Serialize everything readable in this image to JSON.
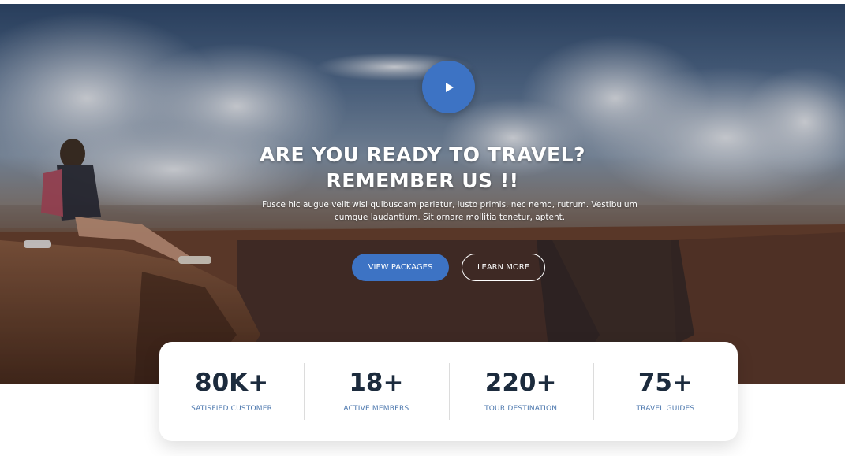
{
  "hero": {
    "headline_line1": "ARE YOU READY TO TRAVEL?",
    "headline_line2": "REMEMBER US !!",
    "subtext": "Fusce hic augue velit wisi quibusdam pariatur, iusto primis, nec nemo, rutrum. Vestibulum cumque laudantium. Sit ornare mollitia tenetur, aptent.",
    "play_icon": "play-icon",
    "accent_color": "#3d73c4"
  },
  "buttons": {
    "primary_label": "VIEW PACKAGES",
    "secondary_label": "LEARN MORE"
  },
  "stats": [
    {
      "value": "80K+",
      "label": "SATISFIED CUSTOMER"
    },
    {
      "value": "18+",
      "label": "ACTIVE MEMBERS"
    },
    {
      "value": "220+",
      "label": "TOUR DESTINATION"
    },
    {
      "value": "75+",
      "label": "TRAVEL GUIDES"
    }
  ],
  "colors": {
    "stat_value": "#1c2b3d",
    "stat_label": "#4a76ad"
  }
}
